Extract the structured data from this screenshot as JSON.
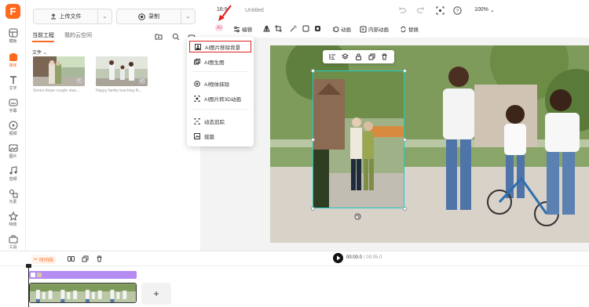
{
  "colors": {
    "accent": "#ff6a1f",
    "selection": "#1ec9c9",
    "highlight": "#dd2222",
    "track_purple": "#b48cf2"
  },
  "rail": {
    "logo": "F",
    "items": [
      {
        "label": "模板",
        "icon": "template-icon"
      },
      {
        "label": "媒体",
        "icon": "media-icon"
      },
      {
        "label": "文字",
        "icon": "text-icon"
      },
      {
        "label": "字幕",
        "icon": "subtitle-icon"
      },
      {
        "label": "视频",
        "icon": "video-icon"
      },
      {
        "label": "图片",
        "icon": "image-icon"
      },
      {
        "label": "音频",
        "icon": "audio-icon"
      },
      {
        "label": "元素",
        "icon": "elements-icon"
      },
      {
        "label": "特效",
        "icon": "effects-icon"
      },
      {
        "label": "工具",
        "icon": "tools-icon"
      }
    ]
  },
  "panel": {
    "upload_label": "上传文件",
    "record_label": "录制",
    "tabs": [
      "当前工程",
      "我的云空间"
    ],
    "section_label": "文件",
    "files": [
      {
        "name": "Senior Asian couple stan..."
      },
      {
        "name": "Happy family teaching th..."
      }
    ]
  },
  "menu": {
    "items": [
      {
        "label": "AI图片移除背景",
        "icon": "remove-bg-icon"
      },
      {
        "label": "AI图生图",
        "icon": "image-to-image-icon"
      },
      {
        "label": "AI物体抹除",
        "icon": "eraser-icon"
      },
      {
        "label": "AI图片转3D动画",
        "icon": "3d-animation-icon"
      },
      {
        "label": "动态追踪",
        "icon": "tracking-icon"
      },
      {
        "label": "裁篇",
        "icon": "crop-icon"
      }
    ]
  },
  "topbar": {
    "ratio": "16:9",
    "title": "Untitled",
    "zoom": "100%"
  },
  "toolbar": {
    "ai_label": "AI",
    "edit_label": "编辑",
    "anim_label": "动画",
    "inner_anim_label": "内部动画",
    "replace_label": "替换"
  },
  "timeline": {
    "timeline_label": "时间线",
    "time_current": "00:00.0",
    "time_total": "/ 00:05.0",
    "add_label": "+"
  }
}
